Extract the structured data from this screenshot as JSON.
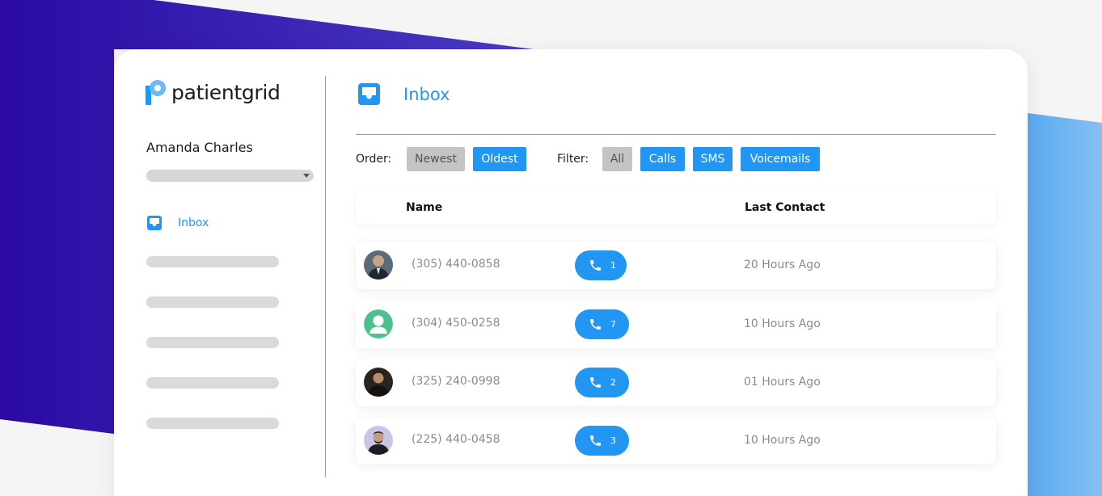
{
  "brand": {
    "name": "patientgrid",
    "accent_color": "#2196f3"
  },
  "sidebar": {
    "user_name": "Amanda Charles",
    "nav_items": [
      {
        "label": "Inbox",
        "icon": "inbox-icon",
        "active": true
      }
    ]
  },
  "main": {
    "title": "Inbox",
    "order": {
      "label": "Order:",
      "options": [
        "Newest",
        "Oldest"
      ],
      "selected": "Newest"
    },
    "filter": {
      "label": "Filter:",
      "options": [
        "All",
        "Calls",
        "SMS",
        "Voicemails"
      ],
      "selected": "All"
    },
    "table": {
      "columns": [
        "Name",
        "Last Contact"
      ],
      "rows": [
        {
          "phone": "(305) 440-0858",
          "calls": "1",
          "last_contact": "20 Hours Ago",
          "avatar": "photo"
        },
        {
          "phone": "(304) 450-0258",
          "calls": "7",
          "last_contact": "10 Hours Ago",
          "avatar": "default-user-icon"
        },
        {
          "phone": "(325) 240-0998",
          "calls": "2",
          "last_contact": "01 Hours Ago",
          "avatar": "photo"
        },
        {
          "phone": "(225) 440-0458",
          "calls": "3",
          "last_contact": "10 Hours Ago",
          "avatar": "photo"
        }
      ]
    }
  }
}
